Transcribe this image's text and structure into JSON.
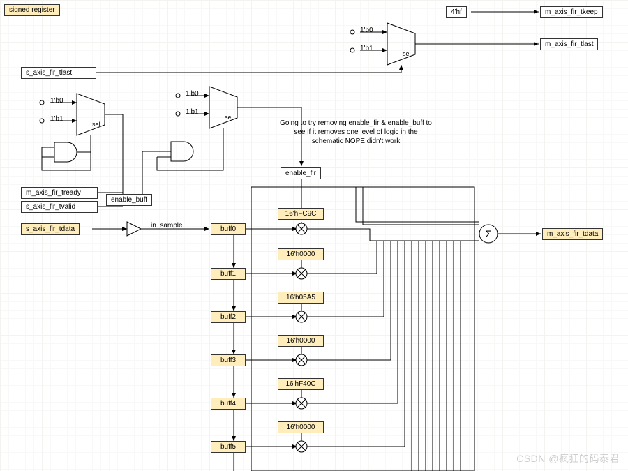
{
  "title": "signed register",
  "inputs": {
    "s_axis_fir_tlast": "s_axis_fir_tlast",
    "m_axis_fir_tready": "m_axis_fir_tready",
    "s_axis_fir_tvalid": "s_axis_fir_tvalid",
    "s_axis_fir_tdata": "s_axis_fir_tdata"
  },
  "outputs": {
    "m_axis_fir_tkeep": "m_axis_fir_tkeep",
    "m_axis_fir_tlast": "m_axis_fir_tlast",
    "m_axis_fir_tdata": "m_axis_fir_tdata"
  },
  "constants": {
    "four_hf": "4'hf",
    "one_b0": "1'b0",
    "one_b1": "1'b1"
  },
  "mux_sel": "sel",
  "enable_buff": "enable_buff",
  "enable_fir": "enable_fir",
  "in_sample": "in_sample",
  "comment": "Going to try removing enable_fir\n& enable_buff to see if it removes one\nlevel of logic in the schematic\nNOPE didn't work",
  "buffers": [
    "buff0",
    "buff1",
    "buff2",
    "buff3",
    "buff4",
    "buff5"
  ],
  "taps": [
    "16'hFC9C",
    "16'h0000",
    "16'h05A5",
    "16'h0000",
    "16'hF40C",
    "16'h0000"
  ],
  "sum_symbol": "Σ",
  "watermark": "CSDN @疯狂的码泰君"
}
